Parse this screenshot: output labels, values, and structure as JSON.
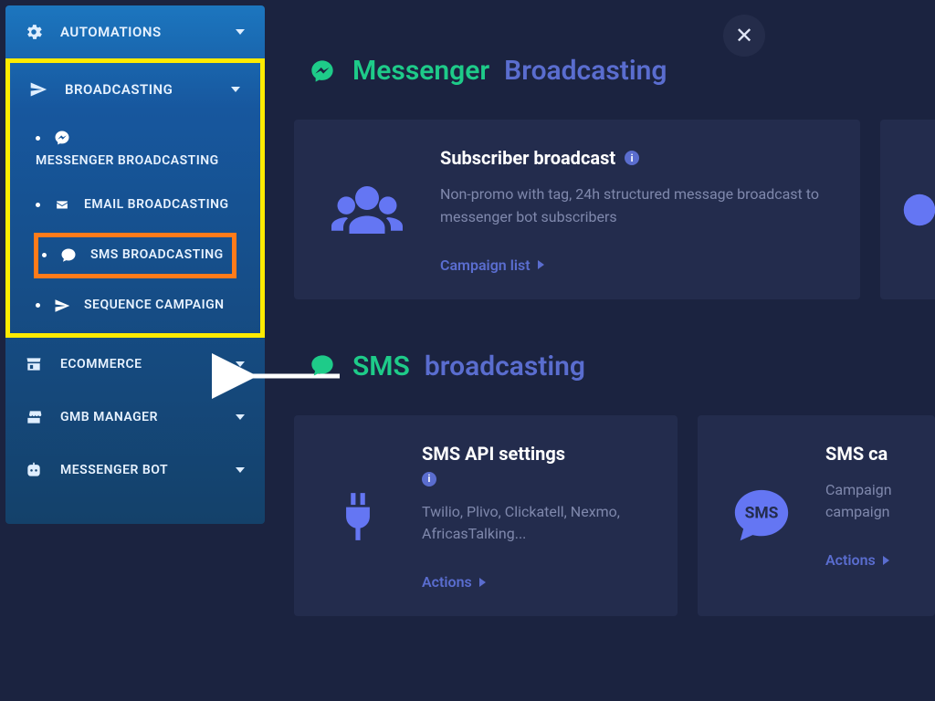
{
  "sidebar": {
    "automations": "AUTOMATIONS",
    "broadcasting": "BROADCASTING",
    "sub_messenger": "MESSENGER BROADCASTING",
    "sub_email": "EMAIL BROADCASTING",
    "sub_sms": "SMS BROADCASTING",
    "sub_sequence": "SEQUENCE CAMPAIGN",
    "ecommerce": "ECOMMERCE",
    "gmb": "GMB MANAGER",
    "messenger_bot": "MESSENGER BOT"
  },
  "main": {
    "close": "×",
    "sec1_a": "Messenger",
    "sec1_b": "Broadcasting",
    "sec2_a": "SMS",
    "sec2_b": "broadcasting",
    "card1_title": "Subscriber broadcast",
    "card1_desc": "Non-promo with tag, 24h structured message broadcast to messenger bot subscribers",
    "card1_link": "Campaign list",
    "card2_title": "SMS API settings",
    "card2_desc": "Twilio, Plivo, Clickatell, Nexmo, AfricasTalking...",
    "card2_link": "Actions",
    "card3_title_prefix": "SMS ca",
    "card3_desc": "Campaign campaign",
    "card3_link": "Actions",
    "info_i": "i"
  },
  "sms_bubble_text": "SMS"
}
